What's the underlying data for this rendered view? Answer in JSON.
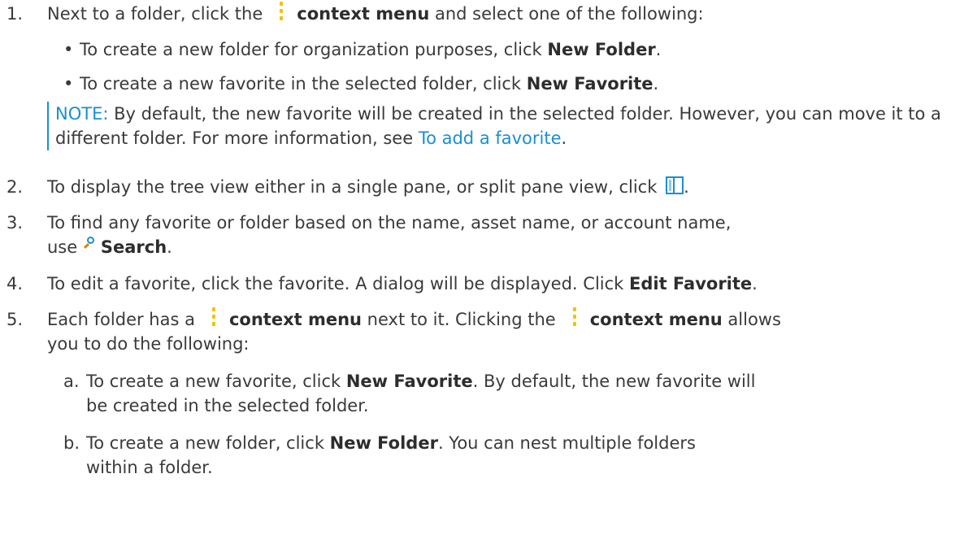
{
  "steps": [
    {
      "num": "1.",
      "pre": "Next to a folder, click the",
      "bold": "context menu",
      "post": " and select one of the following:",
      "bullets": [
        {
          "pre": "To create a new folder for organization purposes, click ",
          "bold": "New Folder",
          "post": "."
        },
        {
          "pre": "To create a new favorite in the selected folder, click ",
          "bold": "New Favorite",
          "post": "."
        }
      ],
      "note": {
        "label": "NOTE:",
        "text": " By default, the new favorite will be created in the selected folder. However, you can move it to a different folder. For more information, see ",
        "link": "To add a favorite",
        "post": "."
      }
    },
    {
      "num": "2.",
      "text": "To display the tree view either in a single pane, or split pane view, click",
      "post": "."
    },
    {
      "num": "3.",
      "line1": "To find any favorite or folder based on the name, asset name, or account name,",
      "line2_pre": "use ",
      "bold": "Search",
      "post": "."
    },
    {
      "num": "4.",
      "pre": "To edit a favorite, click the favorite. A dialog will be displayed. Click ",
      "bold": "Edit Favorite",
      "post": "."
    },
    {
      "num": "5.",
      "pre": "Each folder has a",
      "bold1": "context menu",
      "mid": " next to it. Clicking the",
      "bold2": "context menu",
      "post": " allows",
      "line2": "you to do the following:",
      "subs": [
        {
          "letter": "a.",
          "pre": "To create a new favorite, click ",
          "bold": "New Favorite",
          "post": ". By default, the new favorite will",
          "line2": "be created in the selected folder."
        },
        {
          "letter": "b.",
          "pre": "To create a new folder, click ",
          "bold": "New Folder",
          "post": ". You can nest multiple folders",
          "line2": "within a folder."
        }
      ]
    }
  ],
  "colors": {
    "accent": "#1a8fd0",
    "kebab": "#f2c200",
    "text": "#3a3a3a"
  },
  "icons": [
    "kebab-menu-icon",
    "split-pane-icon",
    "search-icon"
  ]
}
